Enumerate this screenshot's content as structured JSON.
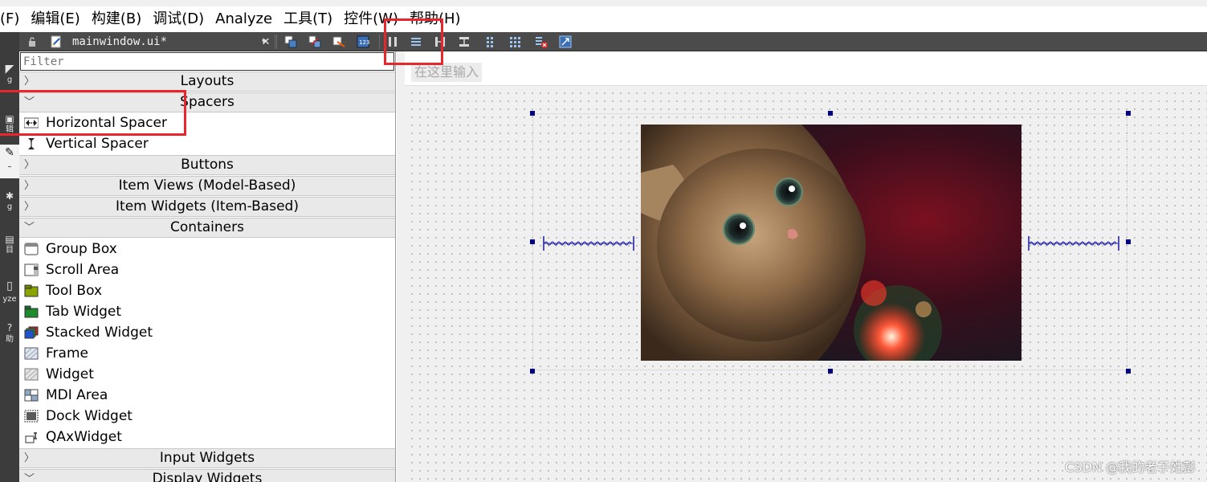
{
  "menubar": {
    "items": [
      "(F)",
      "编辑(E)",
      "构建(B)",
      "调试(D)",
      "Analyze",
      "工具(T)",
      "控件(W)",
      "帮助(H)"
    ]
  },
  "modebar": {
    "labels": [
      "g",
      "辑",
      "g",
      "目",
      "yze",
      "助"
    ]
  },
  "editor_toolbar": {
    "document_name": "mainwindow.ui*",
    "dropdown_glyph": "▾",
    "close_glyph": "✕"
  },
  "widget_box": {
    "filter_placeholder": "Filter",
    "categories": {
      "layouts": "Layouts",
      "spacers": "Spacers",
      "buttons": "Buttons",
      "item_views": "Item Views (Model-Based)",
      "item_widgets": "Item Widgets (Item-Based)",
      "containers": "Containers",
      "input_widgets": "Input Widgets",
      "display_widgets": "Display Widgets"
    },
    "spacers": [
      "Horizontal Spacer",
      "Vertical Spacer"
    ],
    "containers": [
      "Group Box",
      "Scroll Area",
      "Tool Box",
      "Tab Widget",
      "Stacked Widget",
      "Frame",
      "Widget",
      "MDI Area",
      "Dock Widget",
      "QAxWidget"
    ]
  },
  "form": {
    "type_here": "在这里输入"
  },
  "colors": {
    "highlight": "#e8262b",
    "handle": "#000080",
    "dark_toolbar": "#4b4b4b"
  },
  "watermark": "CSDN @我的老子姓彭"
}
